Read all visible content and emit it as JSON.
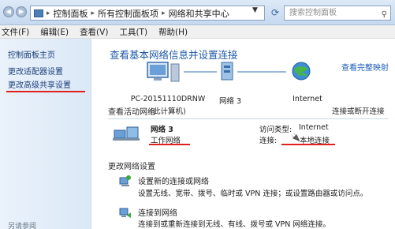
{
  "address_bar": {
    "crumbs": [
      "控制面板",
      "所有控制面板项",
      "网络和共享中心"
    ],
    "search_placeholder": "搜索控制面板"
  },
  "menu": [
    "文件(F)",
    "编辑(E)",
    "查看(V)",
    "工具(T)",
    "帮助(H)"
  ],
  "sidebar": {
    "items": [
      "控制面板主页",
      "更改适配器设置",
      "更改高级共享设置"
    ],
    "footer": "另请参阅"
  },
  "main": {
    "title": "查看基本网络信息并设置连接",
    "full_map_link": "查看完整映射",
    "map": {
      "computer_name": "PC-20151110DRNW",
      "computer_sub": "(此计算机)",
      "network_name": "网络  3",
      "internet": "Internet"
    },
    "active_header": "查看活动网络",
    "connect_disconnect": "连接或断开连接",
    "active_network": {
      "name": "网络  3",
      "type_link": "工作网络",
      "access_label": "访问类型:",
      "access_value": "Internet",
      "conn_label": "连接:",
      "conn_value": "本地连接"
    },
    "change_header": "更改网络设置",
    "tasks": [
      {
        "title": "设置新的连接或网络",
        "desc": "设置无线、宽带、拨号、临时或 VPN 连接；或设置路由器或访问点。"
      },
      {
        "title": "连接到网络",
        "desc": "连接到或重新连接到无线、有线、拨号或 VPN 网络连接。"
      }
    ]
  },
  "colors": {
    "link": "#1c5bb8",
    "title": "#1d5aa6",
    "annotation_red": "#e0201c"
  }
}
